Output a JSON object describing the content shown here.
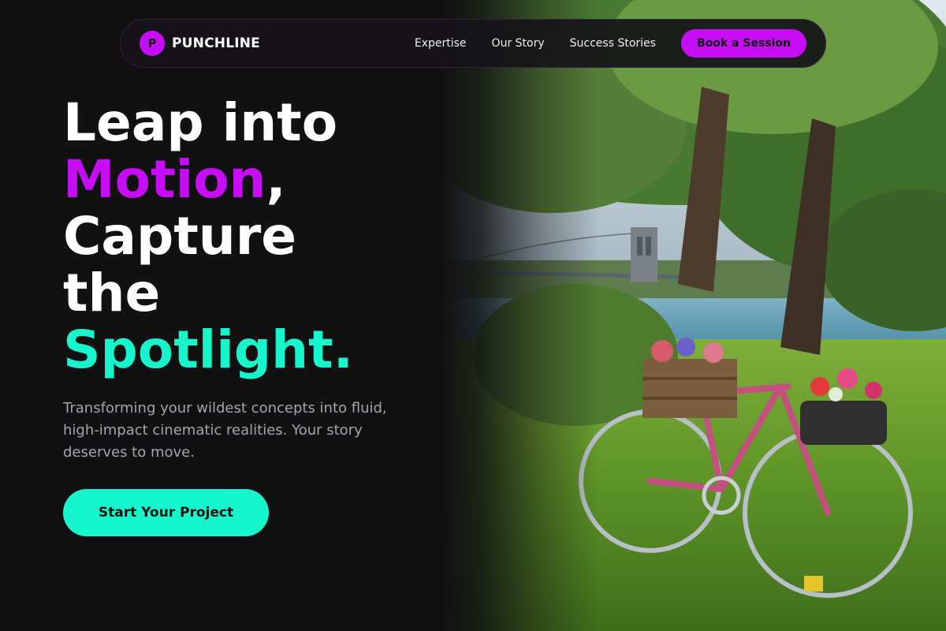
{
  "brand": {
    "logo_letter": "P",
    "name": "PUNCHLINE",
    "accent": "#c70cf7",
    "secondary_accent": "#17f5cc"
  },
  "nav": {
    "links": [
      "Expertise",
      "Our Story",
      "Success Stories"
    ],
    "cta_label": "Book a Session"
  },
  "hero": {
    "headline": {
      "line1": "Leap into",
      "line2_accent": "Motion",
      "line2_rest": ",",
      "line3": "Capture",
      "line4": "the",
      "line5_accent": "Spotlight."
    },
    "subtext": "Transforming your wildest concepts into fluid, high-impact cinematic realities. Your story deserves to move.",
    "cta_label": "Start Your Project",
    "image_subject": "bicycle-with-flower-baskets-by-river-photo"
  }
}
